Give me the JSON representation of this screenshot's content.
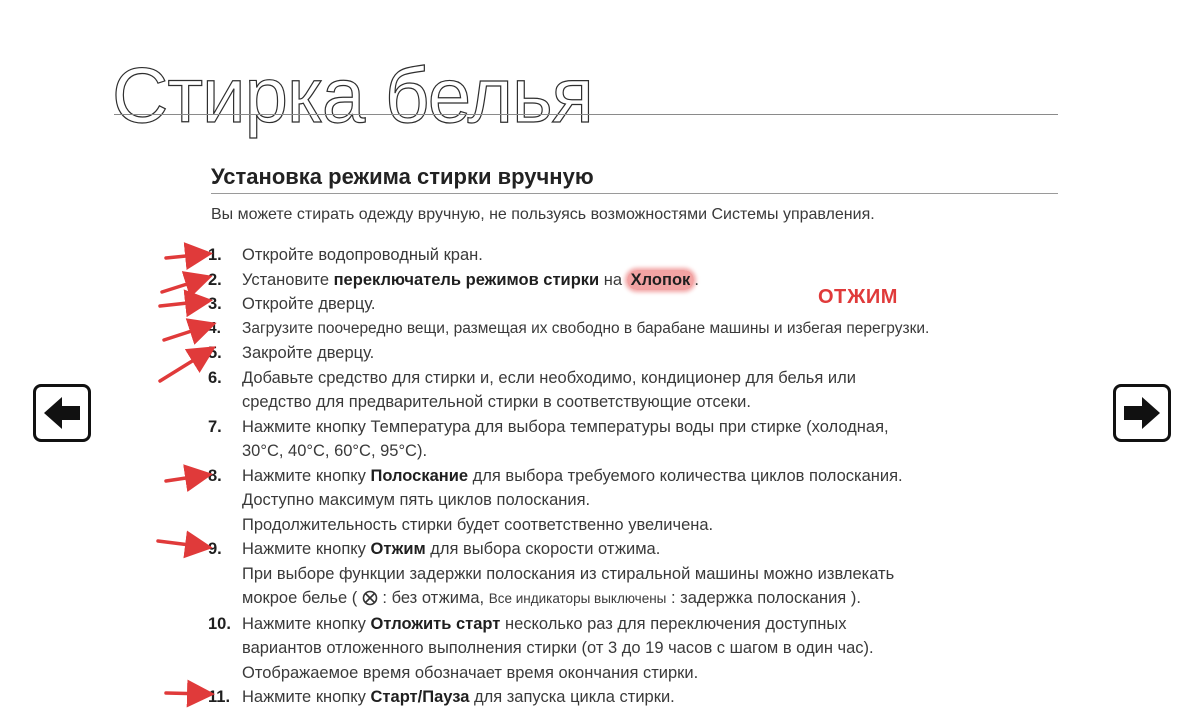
{
  "page": {
    "title": "Стирка белья",
    "section_heading": "Установка режима стирки вручную",
    "intro": "Вы можете стирать одежду вручную, не пользуясь возможностями Системы управления."
  },
  "steps": [
    {
      "num": "1.",
      "parts": [
        "Откройте водопроводный кран."
      ]
    },
    {
      "num": "2.",
      "pre": "Установите ",
      "bold": "переключатель режимов стирки",
      "mid": " на ",
      "highlight": "Хлопок",
      "post": "."
    },
    {
      "num": "3.",
      "parts": [
        "Откройте дверцу."
      ]
    },
    {
      "num": "4.",
      "parts": [
        "Загрузите поочередно вещи, размещая их свободно в барабане машины и избегая перегрузки."
      ]
    },
    {
      "num": "5.",
      "parts": [
        "Закройте дверцу."
      ]
    },
    {
      "num": "6.",
      "parts": [
        "Добавьте средство для стирки и, если необходимо, кондиционер для белья или",
        "средство для предварительной стирки в соответствующие отсеки."
      ]
    },
    {
      "num": "7.",
      "parts": [
        "Нажмите кнопку Температура для выбора температуры воды при стирке (холодная,",
        "30°C, 40°C, 60°C, 95°C)."
      ]
    },
    {
      "num": "8.",
      "pre": "Нажмите кнопку ",
      "bold": "Полоскание",
      "post": " для выбора требуемого количества циклов полоскания.",
      "extra": [
        "Доступно максимум пять циклов полоскания.",
        "Продолжительность стирки будет соответственно увеличена."
      ]
    },
    {
      "num": "9.",
      "pre": "Нажмите кнопку ",
      "bold": "Отжим",
      "post": " для выбора скорости отжима.",
      "extra1": "При выборе функции задержки полоскания из стиральной машины можно извлекать",
      "extra2_a": "мокрое белье (",
      "extra2_b": " : без отжима, ",
      "extra2_small": "Все индикаторы выключены",
      "extra2_c": " : задержка полоскания )."
    },
    {
      "num": "10.",
      "pre": "Нажмите кнопку ",
      "bold": "Отложить старт",
      "post": " несколько раз для переключения доступных",
      "extra": [
        "вариантов отложенного выполнения стирки (от 3 до 19 часов с шагом в один час).",
        "Отображаемое время обозначает время окончания стирки."
      ]
    },
    {
      "num": "11.",
      "pre": "Нажмите кнопку ",
      "bold": "Старт/Пауза",
      "post": " для запуска цикла стирки."
    }
  ],
  "annotation": {
    "text": "ОТЖИМ",
    "color": "#e03a3a"
  },
  "nav": {
    "prev_icon": "arrow-left-icon",
    "next_icon": "arrow-right-icon"
  },
  "colors": {
    "arrow": "#e03a3a",
    "highlight": "#f2a3a3"
  }
}
